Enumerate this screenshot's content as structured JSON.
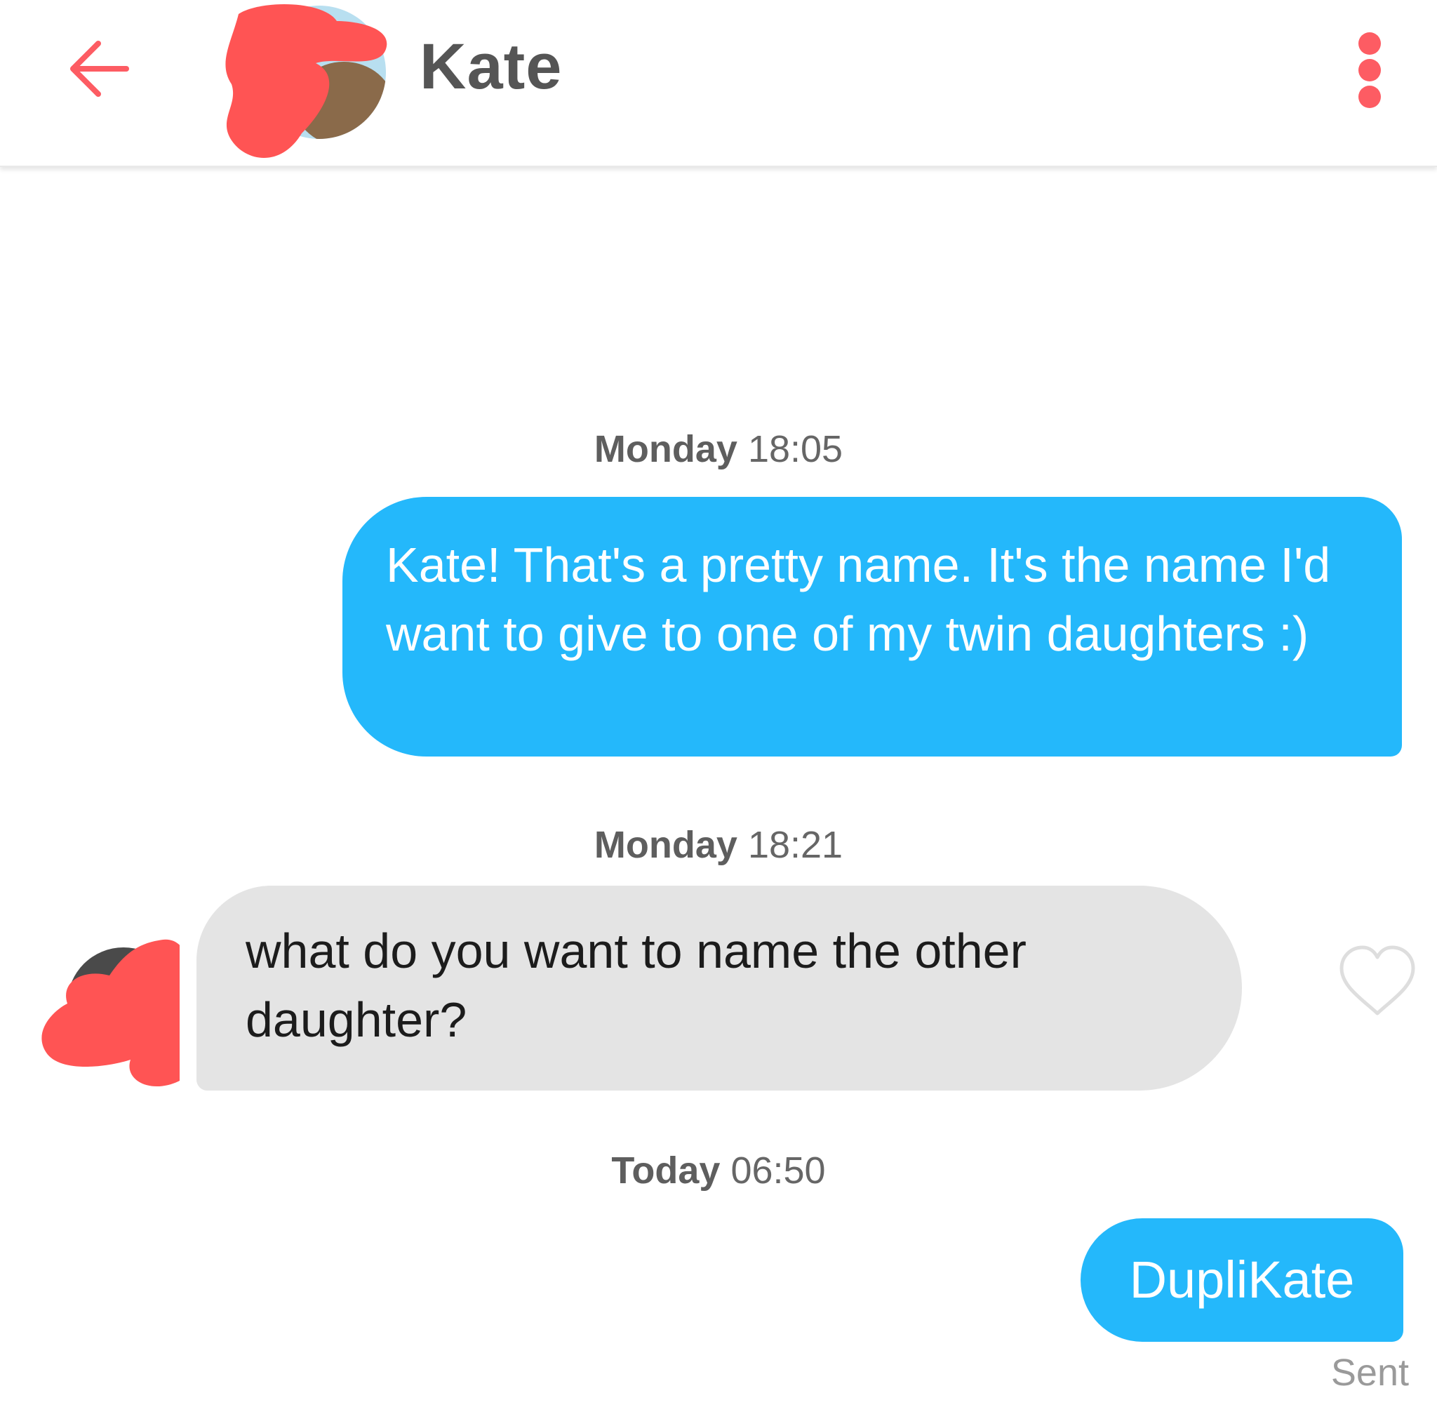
{
  "header": {
    "back_icon": "arrow-left-icon",
    "contact_name": "Kate",
    "menu_icon": "more-vertical-icon",
    "accent_color": "#fd5c63"
  },
  "messages": [
    {
      "timestamp_day": "Monday",
      "timestamp_time": "18:05",
      "direction": "sent",
      "text": "Kate! That's a pretty name. It's the name I'd want to give to one of my twin daughters :)"
    },
    {
      "timestamp_day": "Monday",
      "timestamp_time": "18:21",
      "direction": "received",
      "text": "what do you want to name the other daughter?",
      "like_icon": "heart-outline-icon"
    },
    {
      "timestamp_day": "Today",
      "timestamp_time": "06:50",
      "direction": "sent",
      "text": "DupliKate",
      "status": "Sent"
    }
  ],
  "colors": {
    "sent_bubble": "#24b8fb",
    "received_bubble": "#e4e4e4",
    "redaction": "#ff5454"
  }
}
